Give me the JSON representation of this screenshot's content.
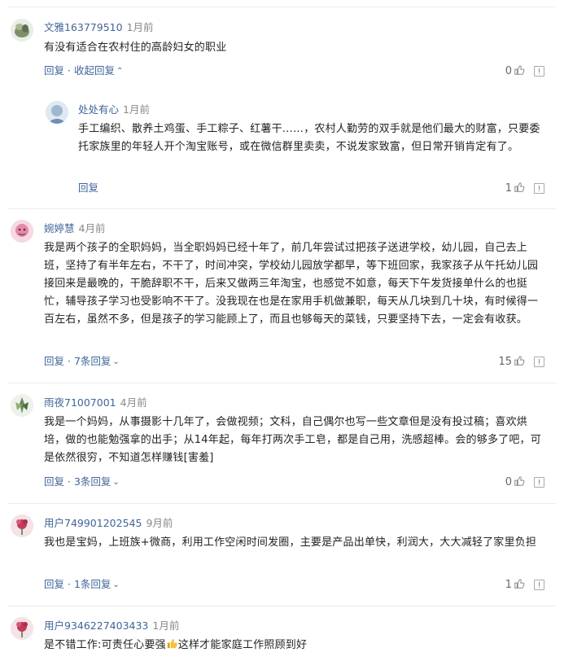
{
  "comments": [
    {
      "username": "文雅163779510",
      "time": "1月前",
      "text": "有没有适合在农村住的高龄妇女的职业",
      "reply_label": "回复",
      "toggle_label": "收起回复",
      "likes": "0",
      "reply": {
        "username": "处处有心",
        "time": "1月前",
        "text": "手工编织、散养土鸡蛋、手工粽子、红薯干……，农村人勤劳的双手就是他们最大的财富，只要委托家族里的年轻人开个淘宝账号，或在微信群里卖卖，不说发家致富，但日常开销肯定有了。",
        "reply_label": "回复",
        "likes": "1"
      }
    },
    {
      "username": "婉婷慧",
      "time": "4月前",
      "text": "我是两个孩子的全职妈妈，当全职妈妈已经十年了，前几年尝试过把孩子送进学校，幼儿园，自己去上班，坚持了有半年左右，不干了，时间冲突，学校幼儿园放学都早，等下班回家，我家孩子从午托幼儿园接回来是最晚的，干脆辞职不干，后来又做两三年淘宝，也感觉不如意，每天下午发货接单什么的也挺忙，辅导孩子学习也受影响不干了。没我现在也是在家用手机做兼职，每天从几块到几十块，有时候得一百左右，虽然不多，但是孩子的学习能顾上了，而且也够每天的菜钱，只要坚持下去，一定会有收获。",
      "reply_label": "回复",
      "toggle_label": "7条回复",
      "likes": "15"
    },
    {
      "username": "雨夜71007001",
      "time": "4月前",
      "text": "我是一个妈妈，从事摄影十几年了，会做视频；文科，自己偶尔也写一些文章但是没有投过稿；喜欢烘培，做的也能勉强拿的出手；从14年起，每年打两次手工皂，都是自己用，洗感超棒。会的够多了吧，可是依然很穷，不知道怎样赚钱[害羞]",
      "reply_label": "回复",
      "toggle_label": "3条回复",
      "likes": "0"
    },
    {
      "username": "用户749901202545",
      "time": "9月前",
      "text": "我也是宝妈，上班族+微商，利用工作空闲时间发圈，主要是产品出单快，利润大，大大减轻了家里负担",
      "reply_label": "回复",
      "toggle_label": "1条回复",
      "likes": "1"
    },
    {
      "username": "用户9346227403433",
      "time": "1月前",
      "text_before": "是不错工作:可责任心要强",
      "text_after": "这样才能家庭工作照顾到好",
      "emoji": "thumbs-up"
    }
  ],
  "icons": {
    "like": "thumbs-up-icon",
    "report": "report-icon",
    "caret_up": "caret-up-icon",
    "caret_down": "caret-down-icon"
  },
  "colors": {
    "link": "#406599",
    "muted": "#888888",
    "text": "#222222",
    "divider": "#ececec"
  }
}
